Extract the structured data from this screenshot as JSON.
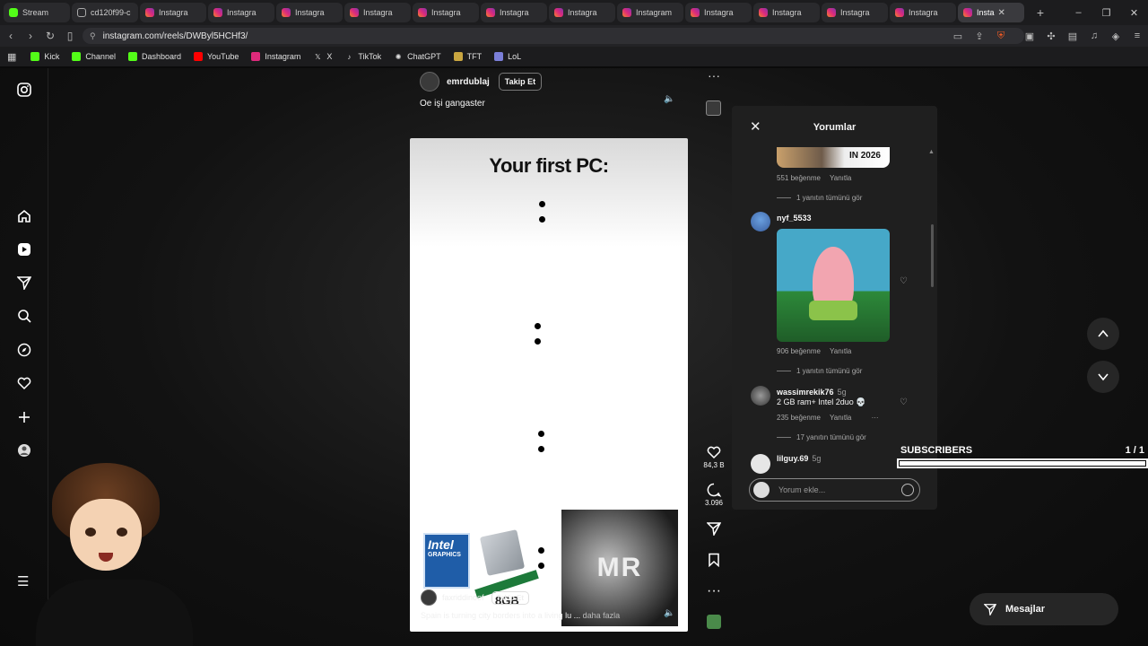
{
  "tabs": [
    {
      "label": "Stream",
      "icon": "kick-icon",
      "active": false
    },
    {
      "label": "cd120f99-c",
      "icon": "globe-icon",
      "active": false
    },
    {
      "label": "Instagra",
      "icon": "instagram-icon",
      "active": false
    },
    {
      "label": "Instagra",
      "icon": "instagram-icon",
      "active": false
    },
    {
      "label": "Instagra",
      "icon": "instagram-icon",
      "active": false
    },
    {
      "label": "Instagra",
      "icon": "instagram-icon",
      "active": false
    },
    {
      "label": "Instagra",
      "icon": "instagram-icon",
      "active": false
    },
    {
      "label": "Instagra",
      "icon": "instagram-icon",
      "active": false
    },
    {
      "label": "Instagra",
      "icon": "instagram-icon",
      "active": false
    },
    {
      "label": "Instagram",
      "icon": "instagram-icon",
      "active": false
    },
    {
      "label": "Instagra",
      "icon": "instagram-icon",
      "active": false
    },
    {
      "label": "Instagra",
      "icon": "instagram-icon",
      "active": false
    },
    {
      "label": "Instagra",
      "icon": "instagram-icon",
      "active": false
    },
    {
      "label": "Instagra",
      "icon": "instagram-icon",
      "active": false
    },
    {
      "label": "Insta",
      "icon": "instagram-icon",
      "active": true
    }
  ],
  "address": {
    "url": "instagram.com/reels/DWByl5HCHf3/"
  },
  "bookmarks": [
    {
      "label": "Kick",
      "icon": "kick-icon"
    },
    {
      "label": "Channel",
      "icon": "kick-icon"
    },
    {
      "label": "Dashboard",
      "icon": "kick-icon"
    },
    {
      "label": "YouTube",
      "icon": "youtube-icon"
    },
    {
      "label": "Instagram",
      "icon": "instagram-icon"
    },
    {
      "label": "X",
      "icon": "x-icon"
    },
    {
      "label": "TikTok",
      "icon": "tiktok-icon"
    },
    {
      "label": "ChatGPT",
      "icon": "chatgpt-icon"
    },
    {
      "label": "TFT",
      "icon": "tft-icon"
    },
    {
      "label": "LoL",
      "icon": "lol-icon"
    }
  ],
  "reel": {
    "username": "emrdublaj",
    "follow": "Takip Et",
    "caption": "Oe işi gangaster",
    "video_title": "Your first PC:",
    "intel_text": "Intel",
    "intel_sub": "GRAPHICS",
    "ram_label": "8GB",
    "mr_text": "MR",
    "inner_user": "faxriddinoof",
    "inner_follow": "Takip Et",
    "inner_caption": "Spain is turning city borders into a living lu ...",
    "inner_more": "daha fazla",
    "likes": "84,3 B",
    "comments_count": "3.096"
  },
  "comments_panel": {
    "title": "Yorumlar",
    "top_image_text": "IN 2026",
    "items": [
      {
        "likes": "551 beğenme",
        "reply": "Yanıtla",
        "view_replies": "1 yanıtın tümünü gör"
      },
      {
        "user": "nyf_5533",
        "likes": "906 beğenme",
        "reply": "Yanıtla",
        "view_replies": "1 yanıtın tümünü gör"
      },
      {
        "user": "wassimrekik76",
        "age": "5g",
        "text": "2 GB ram+ Intel 2duo 💀",
        "likes": "235 beğenme",
        "reply": "Yanıtla",
        "view_replies": "17 yanıtın tümünü gör"
      },
      {
        "user": "lilguy.69",
        "age": "5g"
      }
    ],
    "input_placeholder": "Yorum ekle..."
  },
  "overlay": {
    "subscribers_label": "SUBSCRIBERS",
    "subscribers_count": "1 / 1",
    "subscribers_progress": 1.0
  },
  "messages_label": "Mesajlar"
}
